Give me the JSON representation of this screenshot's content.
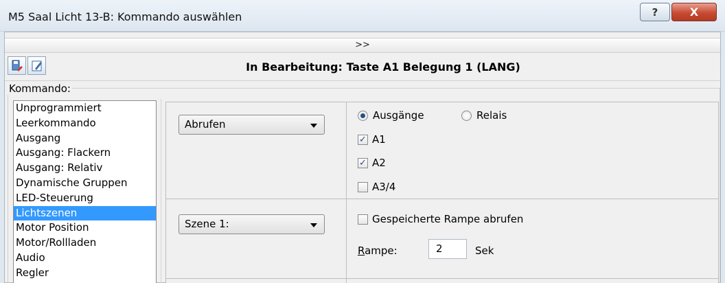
{
  "window": {
    "title": "M5 Saal Licht 13-B: Kommando auswählen",
    "help_glyph": "?",
    "close_glyph": "X"
  },
  "expander": {
    "label": ">>"
  },
  "header": {
    "title": "In Bearbeitung: Taste A1 Belegung 1 (LANG)"
  },
  "kommando": {
    "legend": "Kommando:",
    "items": [
      "Unprogrammiert",
      "Leerkommando",
      "Ausgang",
      "Ausgang: Flackern",
      "Ausgang: Relativ",
      "Dynamische Gruppen",
      "LED-Steuerung",
      "Lichtszenen",
      "Motor Position",
      "Motor/Rollladen",
      "Audio",
      "Regler"
    ],
    "selected": "Lichtszenen"
  },
  "section1": {
    "combo_value": "Abrufen",
    "radio_ausgaenge": "Ausgänge",
    "radio_relais": "Relais",
    "radio_selected": "Ausgänge",
    "checks": [
      {
        "label": "A1",
        "checked": true
      },
      {
        "label": "A2",
        "checked": true
      },
      {
        "label": "A3/4",
        "checked": false
      }
    ]
  },
  "section2": {
    "combo_value": "Szene 1:",
    "gespeichert_label": "Gespeicherte Rampe abrufen",
    "gespeichert_checked": false,
    "rampe_label_first": "R",
    "rampe_label_rest": "ampe:",
    "rampe_value": "2",
    "rampe_unit": "Sek"
  },
  "colors": {
    "selection": "#3399ff",
    "close": "#c74b33"
  }
}
